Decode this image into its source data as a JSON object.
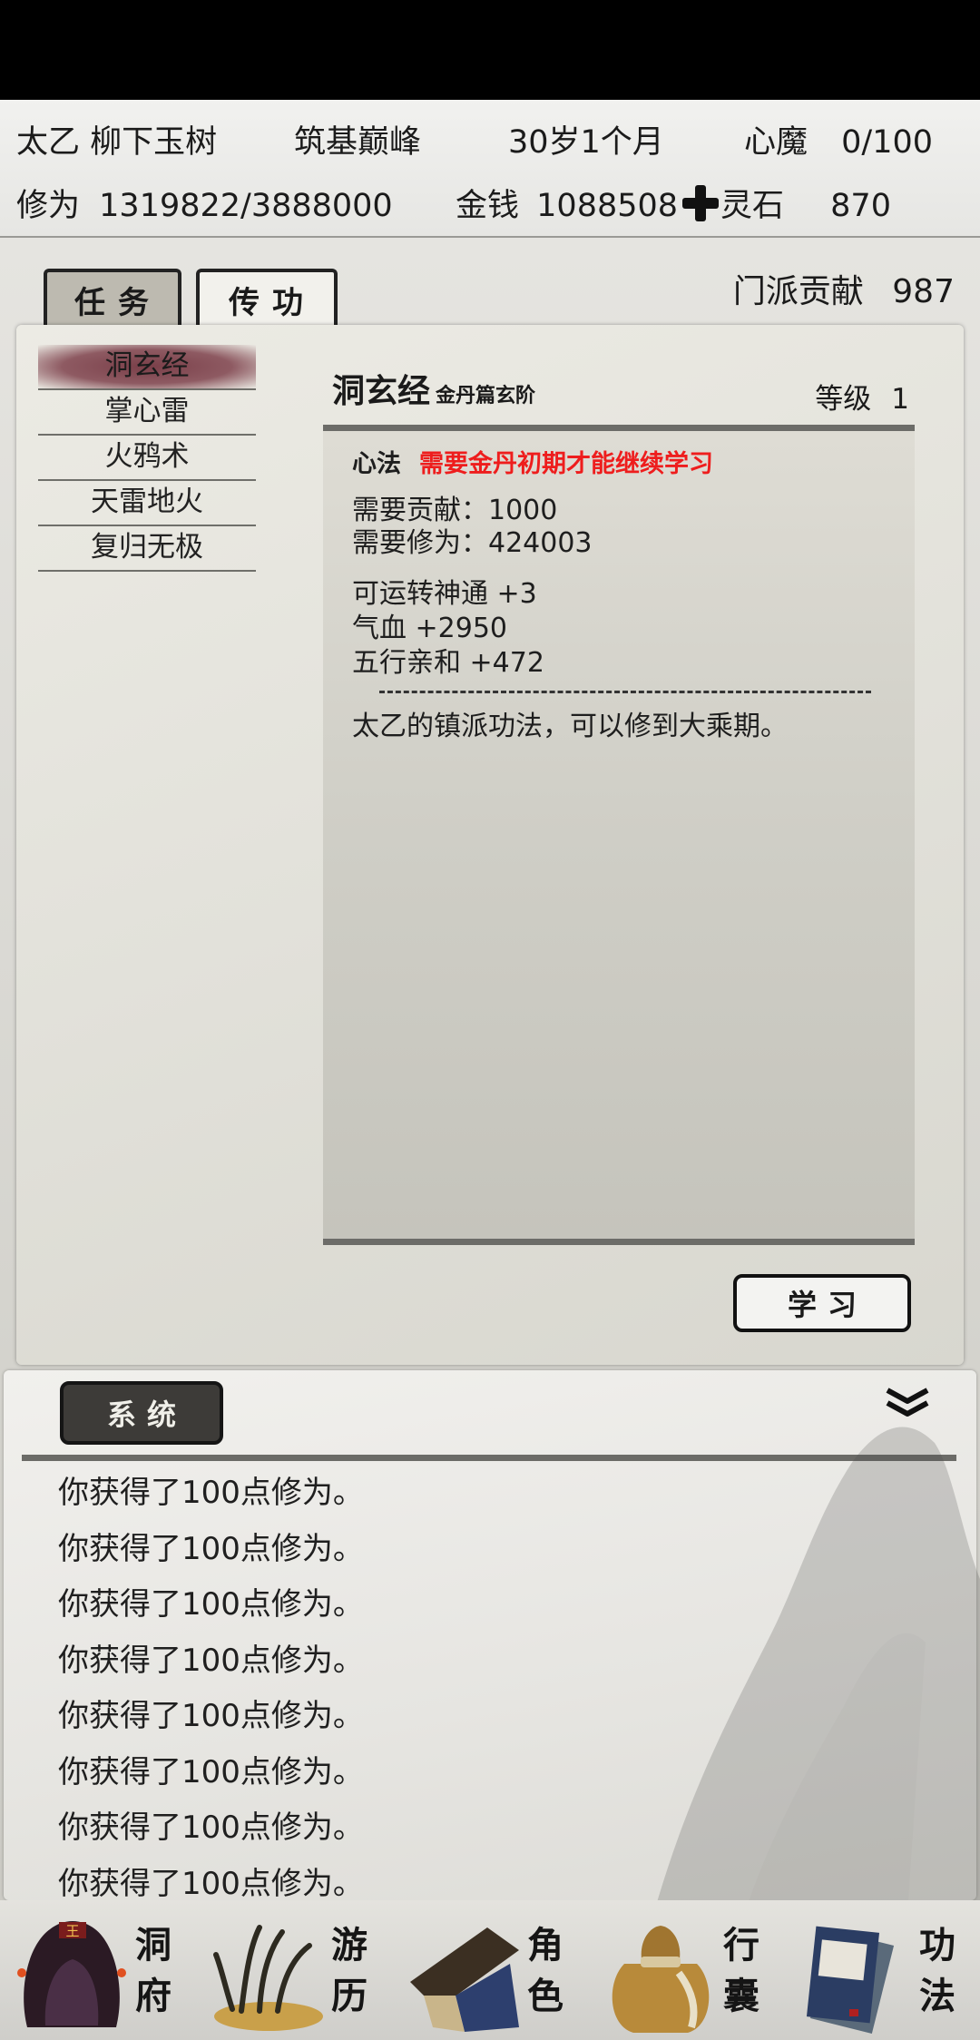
{
  "header": {
    "name": "太乙 柳下玉树",
    "realm": "筑基巅峰",
    "age": "30岁1个月",
    "heart_demon_label": "心魔",
    "heart_demon_value": "0/100",
    "cultivation_label": "修为",
    "cultivation_value": "1319822/3888000",
    "money_label": "金钱",
    "money_value": "1088508",
    "spirit_stone_label": "灵石",
    "spirit_stone_value": "870"
  },
  "tabs": [
    {
      "label": "任务",
      "active": true
    },
    {
      "label": "传功",
      "active": false
    }
  ],
  "contribution": {
    "label": "门派贡献",
    "value": "987"
  },
  "skills": [
    {
      "name": "洞玄经",
      "selected": true
    },
    {
      "name": "掌心雷"
    },
    {
      "name": "火鸦术"
    },
    {
      "name": "天雷地火"
    },
    {
      "name": "复归无极"
    }
  ],
  "detail": {
    "title": "洞玄经",
    "subtitle": "金丹篇玄阶",
    "level_label": "等级",
    "level_value": "1",
    "type": "心法",
    "requirement_warning": "需要金丹初期才能继续学习",
    "need_contribution": "需要贡献：1000",
    "need_cultivation": "需要修为：424003",
    "bonus_1": "可运转神通 +3",
    "bonus_2": "气血 +2950",
    "bonus_3": "五行亲和 +472",
    "description": "太乙的镇派功法，可以修到大乘期。"
  },
  "learn_button": "学习",
  "log": {
    "tab_label": "系统",
    "lines": [
      "你获得了100点修为。",
      "你获得了100点修为。",
      "你获得了100点修为。",
      "你获得了100点修为。",
      "你获得了100点修为。",
      "你获得了100点修为。",
      "你获得了100点修为。",
      "你获得了100点修为。"
    ]
  },
  "nav": [
    {
      "label": "洞府",
      "icon": "cave-dwelling-icon"
    },
    {
      "label": "游历",
      "icon": "travel-grass-icon"
    },
    {
      "label": "角色",
      "icon": "character-hat-icon"
    },
    {
      "label": "行囊",
      "icon": "bag-icon"
    },
    {
      "label": "功法",
      "icon": "books-icon"
    }
  ]
}
